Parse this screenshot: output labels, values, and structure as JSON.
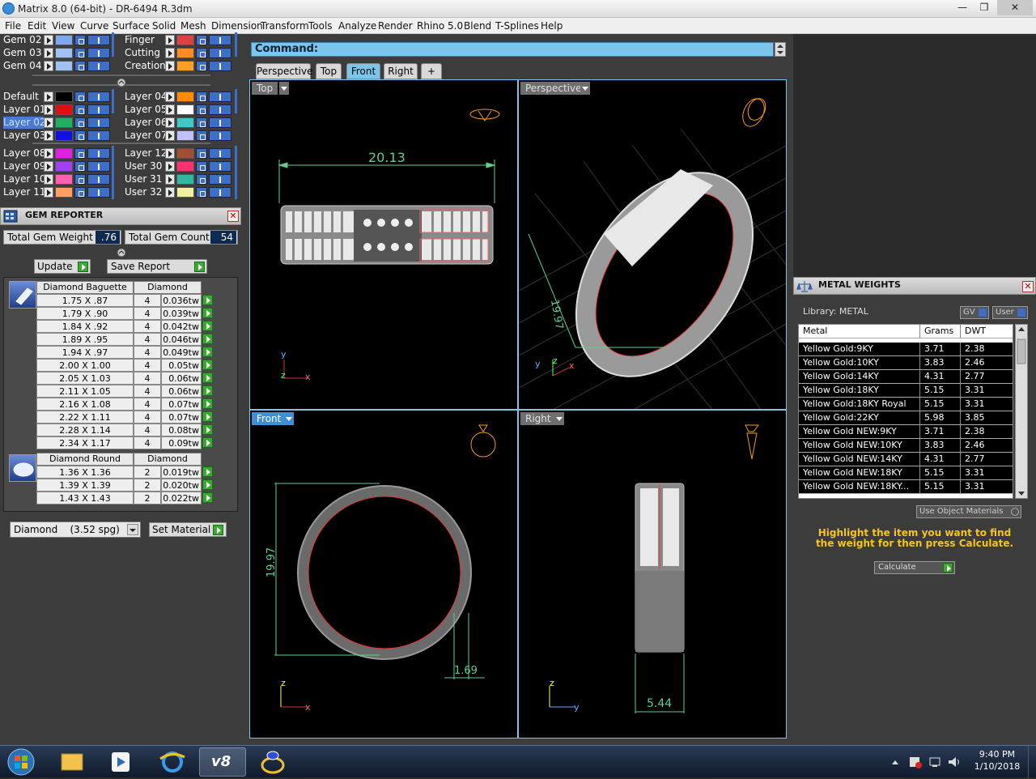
{
  "window": {
    "title": "Matrix 8.0 (64-bit) - DR-6494 R.3dm",
    "minimize": "—",
    "restore": "❐",
    "close": "✕"
  },
  "menu": [
    "File",
    "Edit",
    "View",
    "Curve",
    "Surface",
    "Solid",
    "Mesh",
    "Dimension",
    "Transform",
    "Tools",
    "Analyze",
    "Render",
    "Rhino 5.0",
    "Blend",
    "T-Splines",
    "Help"
  ],
  "layers": {
    "groupA_left": [
      {
        "name": "Gem 02",
        "color": "#7fa8f0"
      },
      {
        "name": "Gem 03",
        "color": "#9ec2f5"
      },
      {
        "name": "Gem 04",
        "color": "#9ec2f5"
      }
    ],
    "groupA_right": [
      {
        "name": "Finger",
        "color": "#e04040"
      },
      {
        "name": "Cutting",
        "color": "#ff8a20"
      },
      {
        "name": "Creation",
        "color": "#ffa020"
      }
    ],
    "groupB_left": [
      {
        "name": "Default",
        "color": "#000000"
      },
      {
        "name": "Layer 01",
        "color": "#e01010"
      },
      {
        "name": "Layer 02",
        "color": "#20b060"
      },
      {
        "name": "Layer 03",
        "color": "#1010e0"
      }
    ],
    "groupB_right": [
      {
        "name": "Layer 04",
        "color": "#ff8c00"
      },
      {
        "name": "Layer 05",
        "color": "#ffffff"
      },
      {
        "name": "Layer 06",
        "color": "#40c8c8"
      },
      {
        "name": "Layer 07",
        "color": "#c0c0ff"
      }
    ],
    "groupC_left": [
      {
        "name": "Layer 08",
        "color": "#e020e0"
      },
      {
        "name": "Layer 09",
        "color": "#a040f0"
      },
      {
        "name": "Layer 10",
        "color": "#ff60b0"
      },
      {
        "name": "Layer 11",
        "color": "#ffa060"
      }
    ],
    "groupC_right": [
      {
        "name": "Layer 12",
        "color": "#a05030"
      },
      {
        "name": "User 30",
        "color": "#ff3070"
      },
      {
        "name": "User 31",
        "color": "#30b8a0"
      },
      {
        "name": "User 32",
        "color": "#f0f0a0"
      }
    ],
    "selected": "Layer 02"
  },
  "gem_reporter": {
    "title": "GEM REPORTER",
    "close": "✕",
    "total_weight_label": "Total Gem Weight",
    "total_weight_value": ".76",
    "total_count_label": "Total Gem Count",
    "total_count_value": "54",
    "update_label": "Update",
    "save_label": "Save Report",
    "baguette": {
      "headers": [
        "Diamond Baguette",
        "Diamond"
      ],
      "rows": [
        [
          "1.75 X .87",
          "4",
          "0.036tw"
        ],
        [
          "1.79 X .90",
          "4",
          "0.039tw"
        ],
        [
          "1.84 X .92",
          "4",
          "0.042tw"
        ],
        [
          "1.89 X .95",
          "4",
          "0.046tw"
        ],
        [
          "1.94 X .97",
          "4",
          "0.049tw"
        ],
        [
          "2.00 X 1.00",
          "4",
          "0.05tw"
        ],
        [
          "2.05 X 1.03",
          "4",
          "0.06tw"
        ],
        [
          "2.11 X 1.05",
          "4",
          "0.06tw"
        ],
        [
          "2.16 X 1.08",
          "4",
          "0.07tw"
        ],
        [
          "2.22 X 1.11",
          "4",
          "0.07tw"
        ],
        [
          "2.28 X 1.14",
          "4",
          "0.08tw"
        ],
        [
          "2.34 X 1.17",
          "4",
          "0.09tw"
        ]
      ]
    },
    "round": {
      "headers": [
        "Diamond Round",
        "Diamond"
      ],
      "rows": [
        [
          "1.36 X 1.36",
          "2",
          "0.019tw"
        ],
        [
          "1.39 X 1.39",
          "2",
          "0.020tw"
        ],
        [
          "1.43 X 1.43",
          "2",
          "0.022tw"
        ]
      ]
    },
    "material_select": "Diamond    (3.52 spg)",
    "set_material_label": "Set Material"
  },
  "command": {
    "label": "Command:"
  },
  "view_tabs": [
    "Perspective",
    "Top",
    "Front",
    "Right",
    "+"
  ],
  "active_tab": "Front",
  "viewports": {
    "top": {
      "label": "Top",
      "dimension": "20.13",
      "axis1": "y",
      "axis2": "z",
      "axis3": "x"
    },
    "perspective": {
      "label": "Perspective",
      "dimension": "19.97",
      "axis1": "z",
      "axis2": "y",
      "axis3": "x"
    },
    "front": {
      "label": "Front",
      "dimension1": "19.97",
      "dimension2": "1.69",
      "axis1": "z",
      "axis2": "x"
    },
    "right": {
      "label": "Right",
      "dimension": "5.44",
      "axis1": "z",
      "axis2": "y"
    }
  },
  "metal_weights": {
    "title": "METAL WEIGHTS",
    "close": "✕",
    "library_label": "Library: METAL",
    "gv_label": "GV",
    "user_label": "User",
    "headers": [
      "Metal",
      "Grams",
      "DWT"
    ],
    "rows": [
      [
        "Yellow Gold:9KY",
        "3.71",
        "2.38"
      ],
      [
        "Yellow Gold:10KY",
        "3.83",
        "2.46"
      ],
      [
        "Yellow Gold:14KY",
        "4.31",
        "2.77"
      ],
      [
        "Yellow Gold:18KY",
        "5.15",
        "3.31"
      ],
      [
        "Yellow Gold:18KY Royal",
        "5.15",
        "3.31"
      ],
      [
        "Yellow Gold:22KY",
        "5.98",
        "3.85"
      ],
      [
        "Yellow Gold NEW:9KY",
        "3.71",
        "2.38"
      ],
      [
        "Yellow Gold NEW:10KY",
        "3.83",
        "2.46"
      ],
      [
        "Yellow Gold NEW:14KY",
        "4.31",
        "2.77"
      ],
      [
        "Yellow Gold NEW:18KY",
        "5.15",
        "3.31"
      ],
      [
        "Yellow Gold NEW:18KY...",
        "5.15",
        "3.31"
      ]
    ],
    "use_object_materials": "Use Object Materials",
    "hint": "Highlight the item you want to find the weight for then press Calculate.",
    "calculate_label": "Calculate"
  },
  "taskbar": {
    "time": "9:40 PM",
    "date": "1/10/2018",
    "matrix_label": "v8"
  },
  "colors": {
    "accent": "#7cc4ea",
    "dimension": "#5fd08a",
    "hint": "#f5c518"
  }
}
